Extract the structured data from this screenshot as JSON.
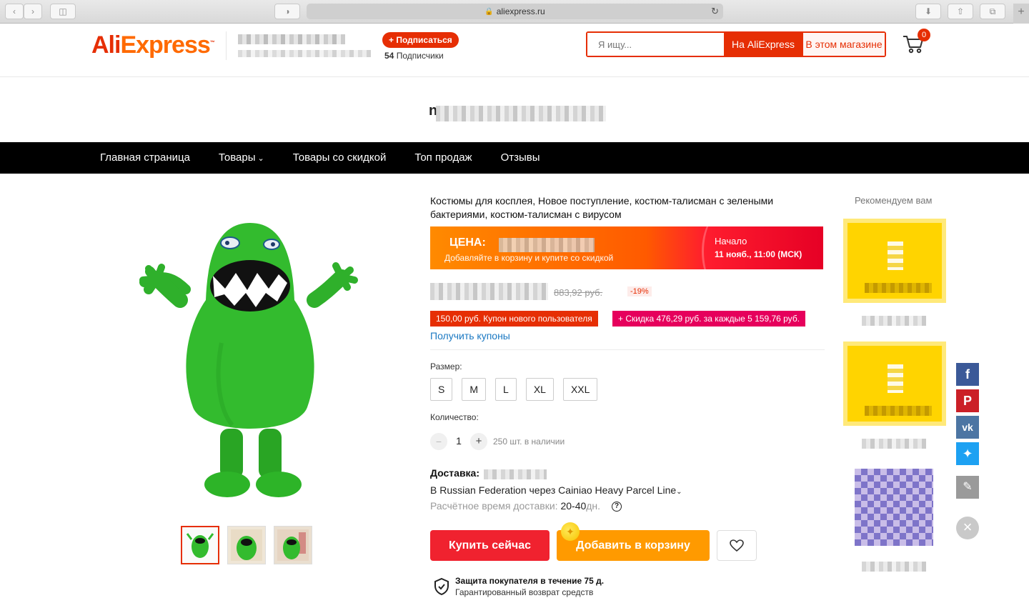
{
  "browser": {
    "url": "aliexpress.ru"
  },
  "header": {
    "logo_left": "Ali",
    "logo_right": "Express",
    "logo_tm": "™",
    "subscribe_label": "+ Подписаться",
    "subscribers_count": "54",
    "subscribers_label": "Подписчики",
    "search_placeholder": "Я ищу...",
    "search_btn_all": "На AliExpress",
    "search_btn_store": "В этом магазине",
    "cart_count": "0"
  },
  "store": {
    "name_fragment": "n"
  },
  "nav": {
    "items": [
      {
        "label": "Главная страница"
      },
      {
        "label": "Товары"
      },
      {
        "label": "Товары со скидкой"
      },
      {
        "label": "Топ продаж"
      },
      {
        "label": "Отзывы"
      }
    ]
  },
  "product": {
    "title": "Костюмы для косплея, Новое поступление, костюм-талисман с зелеными бактериями, костюм-талисман с вирусом",
    "price_banner": {
      "label": "ЦЕНА:",
      "sub": "Добавляйте в корзину и купите со скидкой",
      "start_label": "Начало",
      "start_time": "11 нояб., 11:00 (МСК)"
    },
    "old_price": "883,92 руб.",
    "discount": "-19%",
    "coupon_new_user": "150,00 руб. Купон нового пользователя",
    "coupon_store": "+ Скидка 476,29 руб. за каждые 5 159,76 руб.",
    "get_coupons": "Получить купоны",
    "size_label": "Размер:",
    "sizes": [
      "S",
      "M",
      "L",
      "XL",
      "XXL"
    ],
    "qty_label": "Количество:",
    "qty_value": "1",
    "stock": "250 шт. в наличии",
    "shipping_label": "Доставка:",
    "shipping_route": "В Russian Federation через Cainiao Heavy Parcel Line",
    "shipping_time_label": "Расчётное время доставки:",
    "shipping_time_value": "20-40",
    "shipping_time_unit": "дн.",
    "buy_now": "Купить сейчас",
    "add_to_cart": "Добавить в корзину",
    "protection_title": "Защита покупателя в течение 75 д.",
    "protection_sub": "Гарантированный возврат средств"
  },
  "recommend": {
    "title": "Рекомендуем вам"
  },
  "colors": {
    "brand_red": "#e62e04",
    "brand_orange": "#ff9a00",
    "link_blue": "#1a78c2"
  }
}
